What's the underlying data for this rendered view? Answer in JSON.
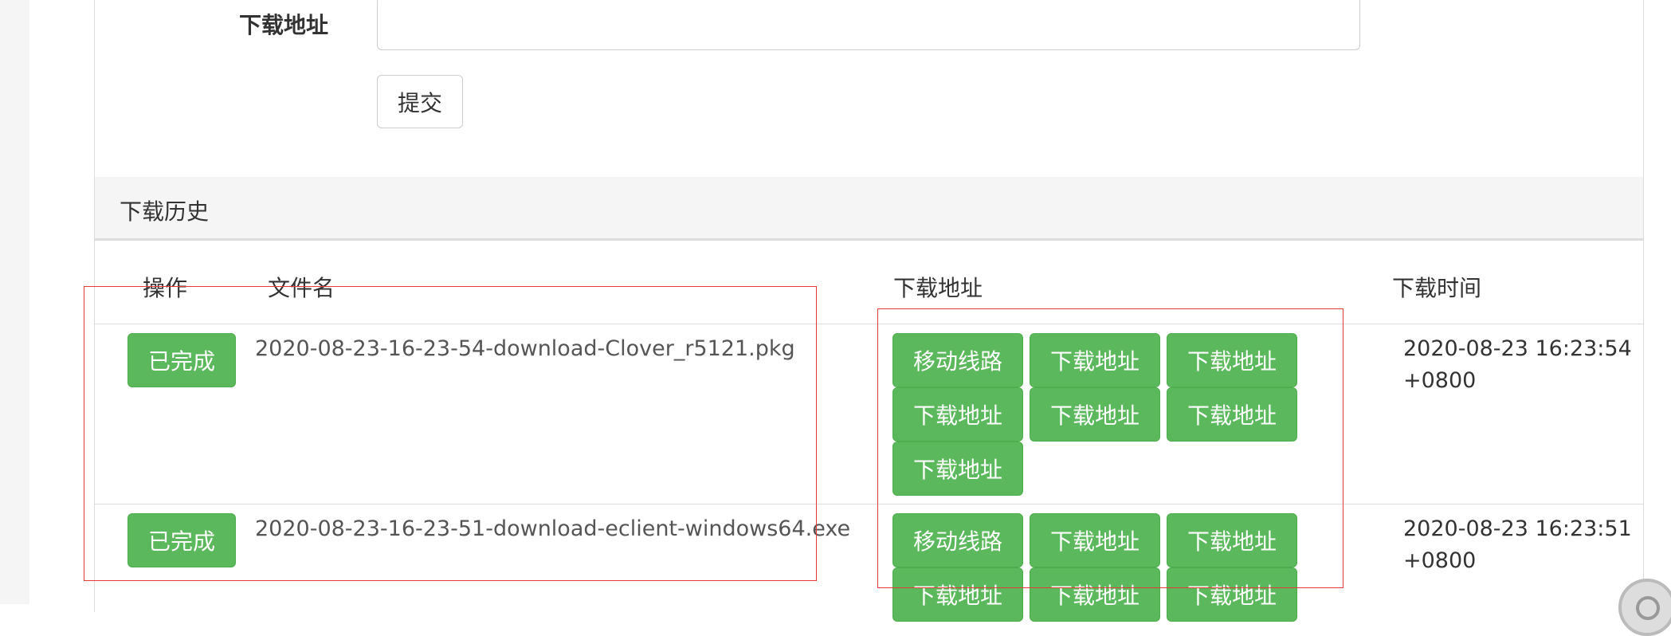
{
  "form": {
    "label": "下载地址",
    "input_value": "",
    "input_placeholder": "",
    "submit_label": "提交"
  },
  "history": {
    "title": "下载历史",
    "columns": {
      "action": "操作",
      "filename": "文件名",
      "url": "下载地址",
      "time": "下载时间"
    },
    "rows": [
      {
        "status": "已完成",
        "filename": "2020-08-23-16-23-54-download-Clover_r5121.pkg",
        "links": [
          "移动线路",
          "下载地址",
          "下载地址",
          "下载地址",
          "下载地址",
          "下载地址",
          "下载地址"
        ],
        "time_line1": "2020-08-23 16:23:54",
        "time_line2": "+0800"
      },
      {
        "status": "已完成",
        "filename": "2020-08-23-16-23-51-download-eclient-windows64.exe",
        "links": [
          "移动线路",
          "下载地址",
          "下载地址",
          "下载地址",
          "下载地址",
          "下载地址"
        ],
        "time_line1": "2020-08-23 16:23:51",
        "time_line2": "+0800"
      }
    ]
  },
  "colors": {
    "success_green": "#5cb85c",
    "annotation_red": "#e53935",
    "panel_header_bg": "#f5f5f5"
  }
}
